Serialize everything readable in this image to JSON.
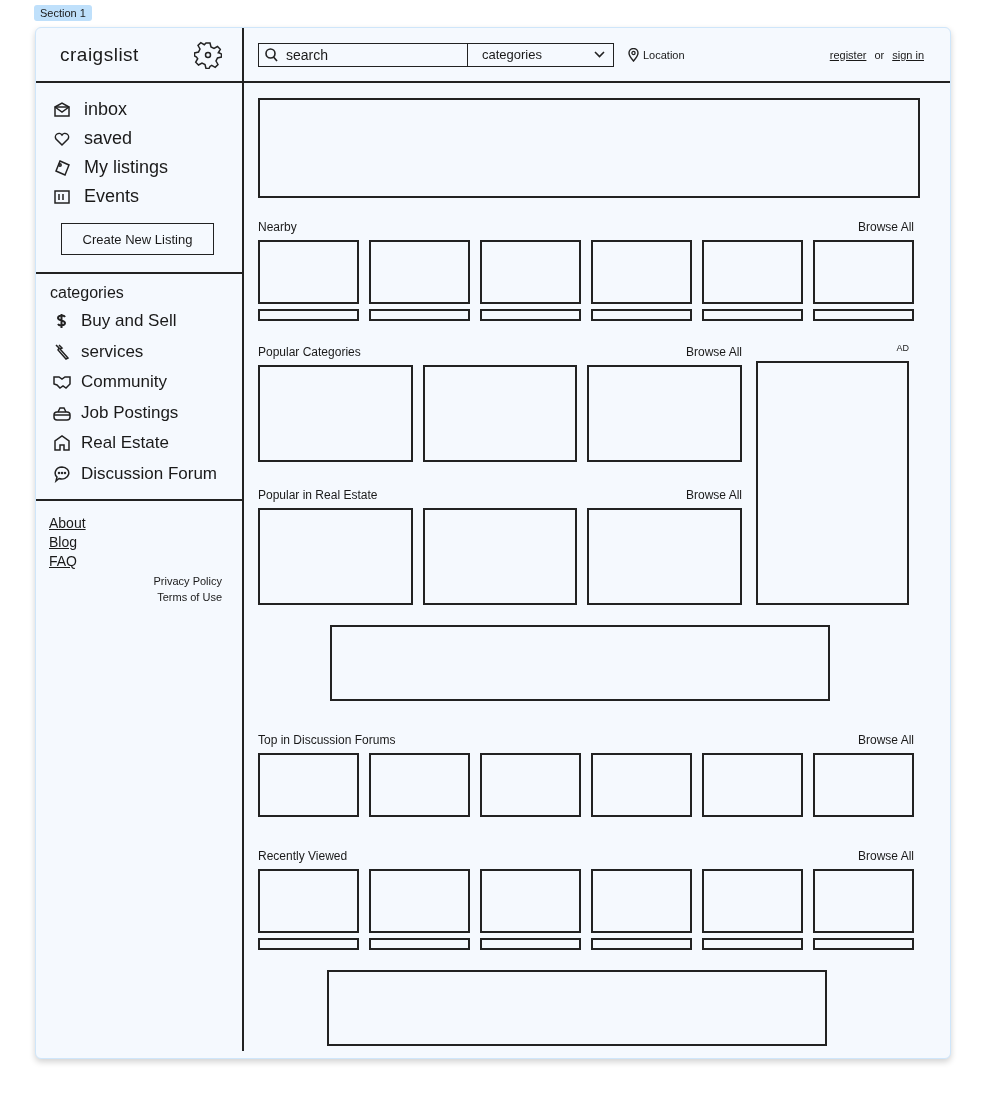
{
  "section_label": "Section 1",
  "logo": "craigslist",
  "search": {
    "placeholder": "search"
  },
  "category_select": {
    "value": "categories"
  },
  "location": "Location",
  "auth": {
    "register": "register",
    "or": "or",
    "sign_in": "sign in"
  },
  "nav": [
    "inbox",
    "saved",
    "My listings",
    "Events"
  ],
  "create_button": "Create New Listing",
  "categories_heading": "categories",
  "categories": [
    "Buy and Sell",
    "services",
    "Community",
    "Job Postings",
    "Real Estate",
    "Discussion Forum"
  ],
  "footer_links": [
    "About",
    "Blog",
    "FAQ"
  ],
  "legal_links": [
    "Privacy Policy",
    "Terms of Use"
  ],
  "content": [
    {
      "kind": "hero"
    },
    {
      "kind": "strip",
      "title": "Nearby",
      "browse": "Browse All",
      "captions": true
    },
    {
      "kind": "featured",
      "groups": [
        {
          "title": "Popular Categories",
          "browse": "Browse All"
        },
        {
          "title": "Popular in Real Estate",
          "browse": "Browse All"
        }
      ],
      "ad": "AD"
    },
    {
      "kind": "banner"
    },
    {
      "kind": "strip",
      "title": "Top in Discussion Forums",
      "browse": "Browse All",
      "captions": false
    },
    {
      "kind": "strip",
      "title": "Recently Viewed",
      "browse": "Browse All",
      "captions": true
    },
    {
      "kind": "banner"
    }
  ]
}
